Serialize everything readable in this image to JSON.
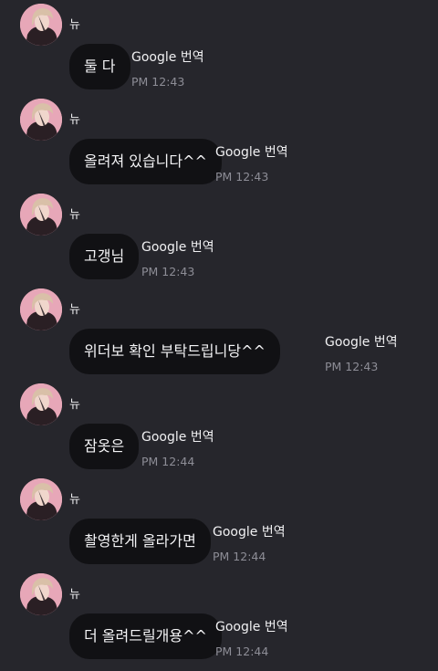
{
  "chat": {
    "translate_label": "Google 번역",
    "messages": [
      {
        "sender": "뉴",
        "text": "둘 다",
        "time": "PM 12:43"
      },
      {
        "sender": "뉴",
        "text": "올려져 있습니다^^",
        "time": "PM 12:43"
      },
      {
        "sender": "뉴",
        "text": "고갱님",
        "time": "PM 12:43"
      },
      {
        "sender": "뉴",
        "text": "위더보 확인 부탁드립니당^^",
        "time": "PM 12:43"
      },
      {
        "sender": "뉴",
        "text": "잠옷은",
        "time": "PM 12:44"
      },
      {
        "sender": "뉴",
        "text": "촬영한게 올라가면",
        "time": "PM 12:44"
      },
      {
        "sender": "뉴",
        "text": "더 올려드릴개용^^",
        "time": "PM 12:44"
      }
    ]
  }
}
